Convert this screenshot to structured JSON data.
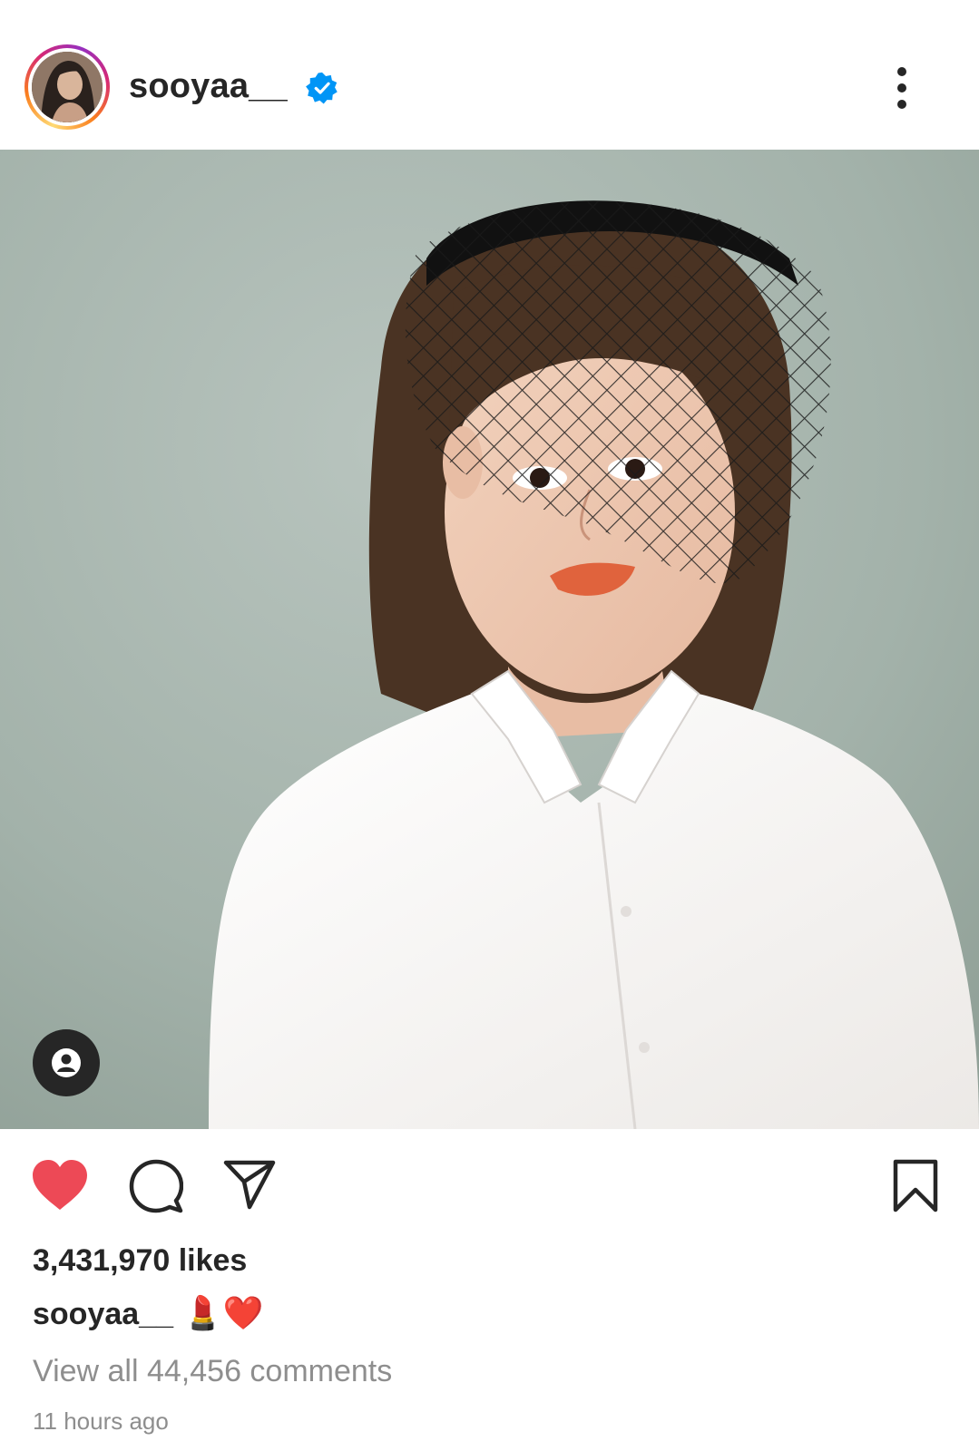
{
  "post": {
    "username": "sooyaa__",
    "verified": true,
    "likes_text": "3,431,970 likes",
    "caption": {
      "username": "sooyaa__",
      "text": "💄❤️"
    },
    "view_comments_text": "View all 44,456 comments",
    "timestamp": "11 hours ago"
  },
  "icons": {
    "verified": "verified-badge-icon",
    "more": "more-options-icon",
    "tag": "tagged-people-icon",
    "like": "heart-icon",
    "comment": "comment-icon",
    "share": "share-icon",
    "save": "bookmark-icon"
  },
  "colors": {
    "text": "#262626",
    "muted": "#8e8e8e",
    "like_red": "#ed4956",
    "verified_blue": "#0095f6",
    "photo_background": "#aab8b1"
  },
  "state": {
    "liked": true,
    "saved": false
  }
}
